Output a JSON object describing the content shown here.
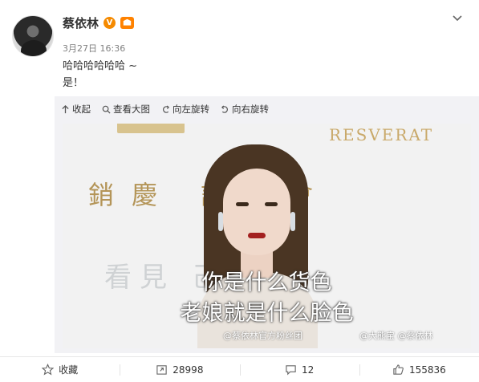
{
  "post": {
    "author_name": "蔡依林",
    "badge_v": "V",
    "badge_member": "会",
    "timestamp": "3月27日 16:36",
    "text_line1": "哈哈哈哈哈哈 ~",
    "text_line2": "是！"
  },
  "media": {
    "toolbar": {
      "collapse": "收起",
      "view_large": "查看大图",
      "rotate_left": "向左旋转",
      "rotate_right": "向右旋转"
    },
    "background_text_top": "RESVERAT",
    "background_text_mid": "銷慶 記者會",
    "background_text_low": "看見 己",
    "caption_line1": "你是什么货色",
    "caption_line2": "老娘就是什么脸色",
    "watermark_1": "@蔡依林官方粉丝团",
    "watermark_2": "@大熊宝 @蔡依林"
  },
  "footer": {
    "favorite": "收藏",
    "repost_count": "28998",
    "comment_count": "12",
    "like_count": "155836"
  },
  "colors": {
    "accent_orange": "#ff8200",
    "text_gray": "#808080"
  }
}
